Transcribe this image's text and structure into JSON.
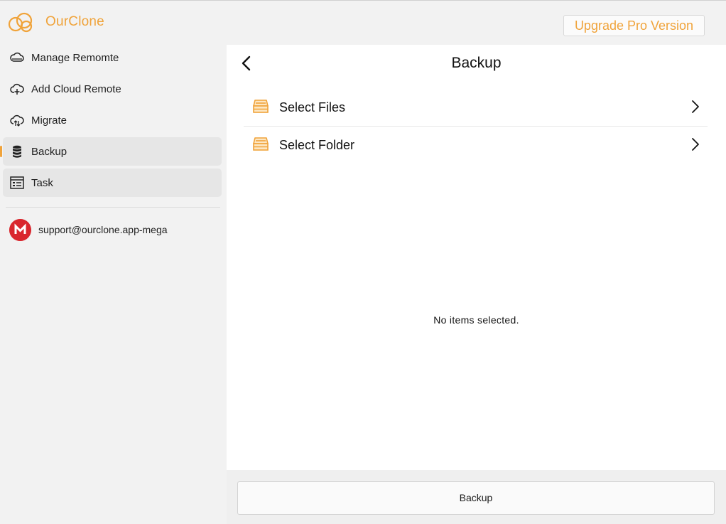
{
  "app": {
    "title": "OurClone",
    "upgrade_label": "Upgrade Pro Version",
    "accent": "#f0a33a"
  },
  "sidebar": {
    "items": [
      {
        "label": "Manage Remomte",
        "icon": "cloud-icon"
      },
      {
        "label": "Add Cloud Remote",
        "icon": "cloud-add-icon"
      },
      {
        "label": "Migrate",
        "icon": "cloud-sync-icon"
      },
      {
        "label": "Backup",
        "icon": "database-icon",
        "active": true
      },
      {
        "label": "Task",
        "icon": "task-list-icon"
      }
    ],
    "account": {
      "label": "support@ourclone.app-mega",
      "icon": "mega-icon",
      "color": "#d9272e"
    }
  },
  "main": {
    "title": "Backup",
    "options": [
      {
        "label": "Select Files",
        "icon": "drive-icon"
      },
      {
        "label": "Select Folder",
        "icon": "drive-icon"
      }
    ],
    "empty_message": "No items selected.",
    "backup_label": "Backup"
  }
}
